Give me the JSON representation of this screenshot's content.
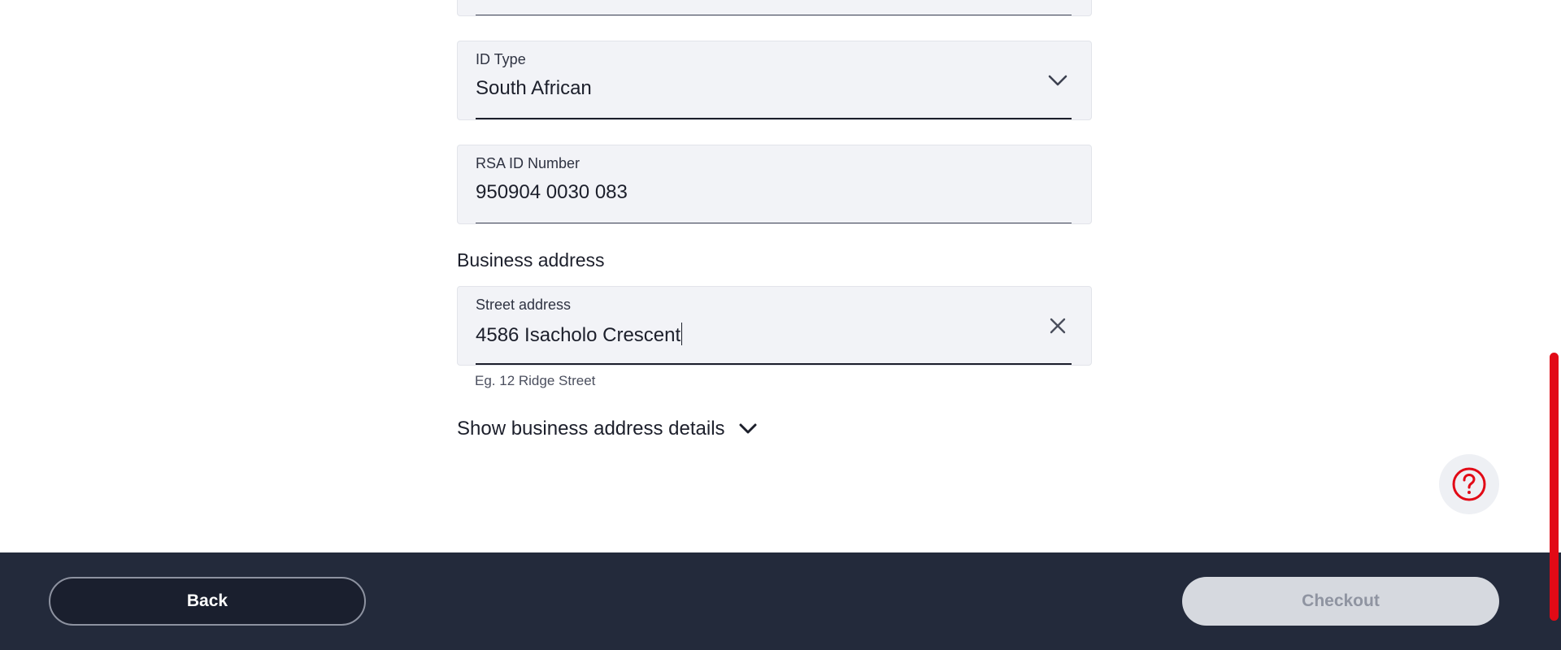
{
  "form": {
    "id_type": {
      "label": "ID Type",
      "value": "South African",
      "icon": "chevron-down-icon"
    },
    "rsa_id": {
      "label": "RSA ID Number",
      "value": "950904 0030 083"
    },
    "business_address": {
      "heading": "Business address",
      "street": {
        "label": "Street address",
        "value": "4586 Isacholo Crescent",
        "helper": "Eg. 12 Ridge Street",
        "clear_icon": "close-icon"
      },
      "toggle_label": "Show business address details",
      "toggle_icon": "chevron-down-icon"
    }
  },
  "help": {
    "icon": "question-circle-icon",
    "color": "#e20a16"
  },
  "footer": {
    "back_label": "Back",
    "checkout_label": "Checkout",
    "background": "#232a3b"
  },
  "colors": {
    "accent": "#e20a16",
    "field_bg": "#f2f3f7",
    "text": "#1c1f2b"
  }
}
